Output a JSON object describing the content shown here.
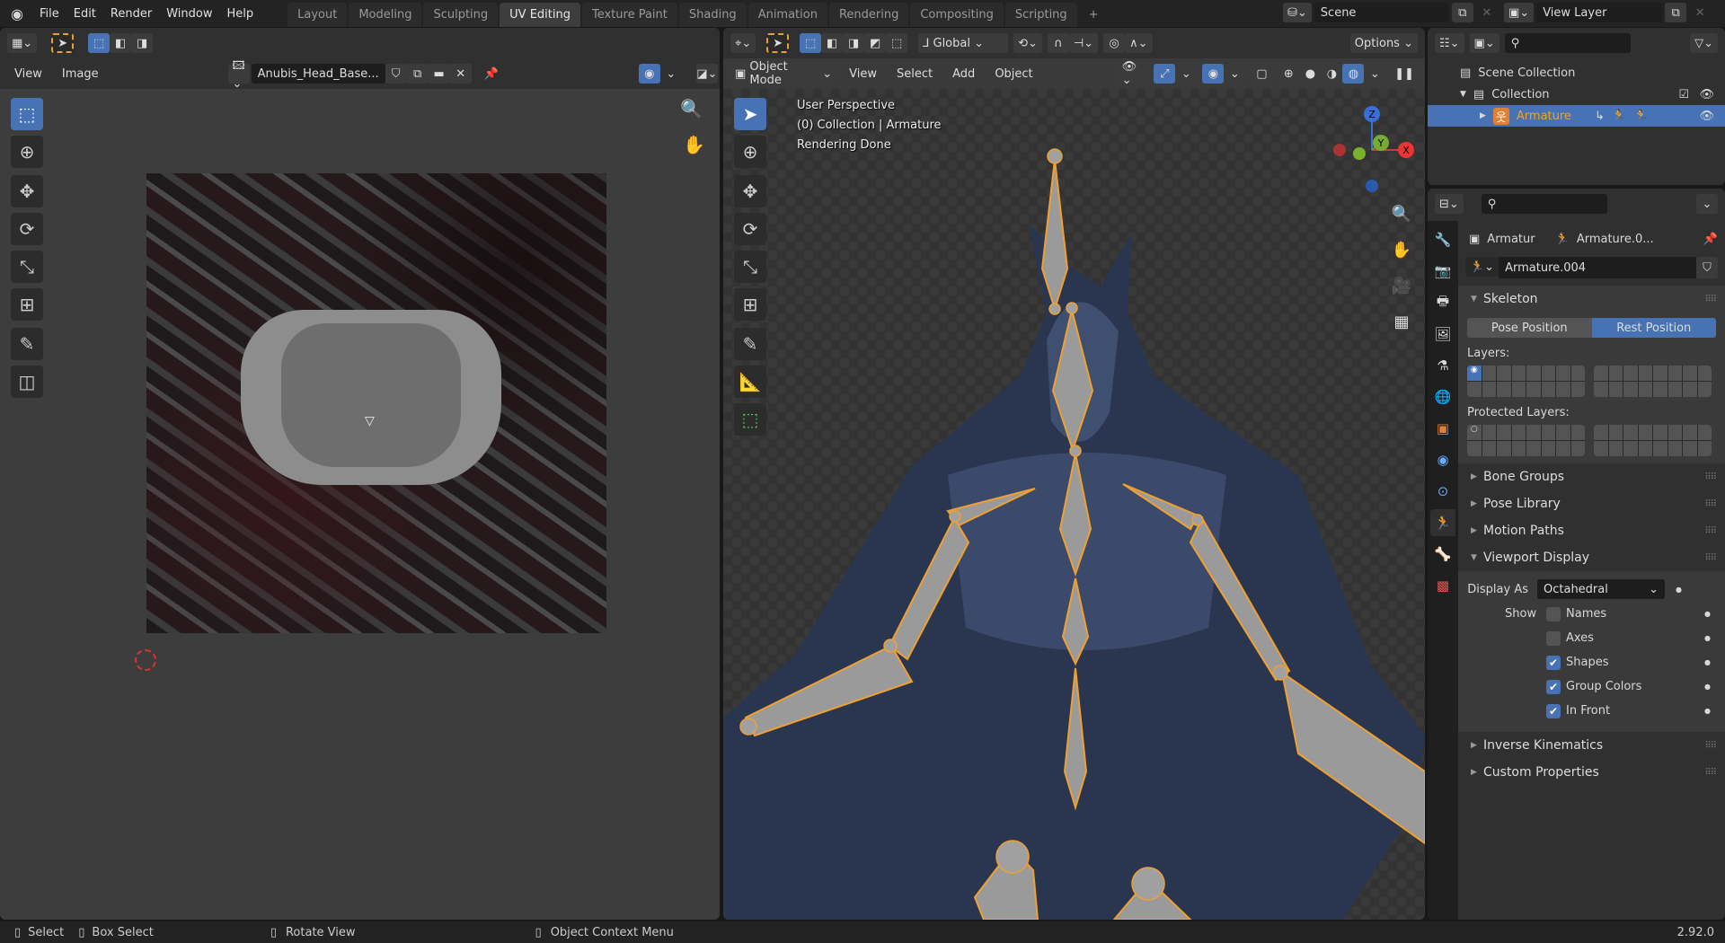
{
  "topbar": {
    "menus": [
      "File",
      "Edit",
      "Render",
      "Window",
      "Help"
    ],
    "workspaces": [
      "Layout",
      "Modeling",
      "Sculpting",
      "UV Editing",
      "Texture Paint",
      "Shading",
      "Animation",
      "Rendering",
      "Compositing",
      "Scripting"
    ],
    "active_workspace": "UV Editing",
    "add_tab": "+",
    "scene": "Scene",
    "view_layer": "View Layer"
  },
  "uv_editor": {
    "menus": [
      "View",
      "Image"
    ],
    "image_name": "Anubis_Head_Base..."
  },
  "viewport": {
    "mode": "Object Mode",
    "menus": [
      "View",
      "Select",
      "Add",
      "Object"
    ],
    "orientation": "Global",
    "options": "Options",
    "overlay_text": [
      "User Perspective",
      "(0) Collection | Armature",
      "Rendering Done"
    ],
    "gizmo": {
      "z": "Z",
      "y": "Y",
      "x": "X"
    }
  },
  "outliner": {
    "items": [
      {
        "label": "Scene Collection"
      },
      {
        "label": "Collection"
      },
      {
        "label": "Armature"
      }
    ]
  },
  "properties": {
    "object_name": "Armatur",
    "data_name": "Armature.0...",
    "datablock": "Armature.004",
    "panels": {
      "skeleton": "Skeleton",
      "pose_position": "Pose Position",
      "rest_position": "Rest Position",
      "layers": "Layers:",
      "protected_layers": "Protected Layers:",
      "bone_groups": "Bone Groups",
      "pose_library": "Pose Library",
      "motion_paths": "Motion Paths",
      "viewport_display": "Viewport Display",
      "display_as_label": "Display As",
      "display_as": "Octahedral",
      "show_label": "Show",
      "inverse_kinematics": "Inverse Kinematics",
      "custom_properties": "Custom Properties"
    },
    "show": [
      {
        "label": "Names",
        "checked": false
      },
      {
        "label": "Axes",
        "checked": false
      },
      {
        "label": "Shapes",
        "checked": true
      },
      {
        "label": "Group Colors",
        "checked": true
      },
      {
        "label": "In Front",
        "checked": true
      }
    ]
  },
  "status": {
    "select": "Select",
    "box_select": "Box Select",
    "rotate": "Rotate View",
    "context": "Object Context Menu",
    "version": "2.92.0"
  },
  "colors": {
    "accent": "#4772b3",
    "bone_outline": "#f0a030",
    "selected_text": "#f0a030"
  }
}
